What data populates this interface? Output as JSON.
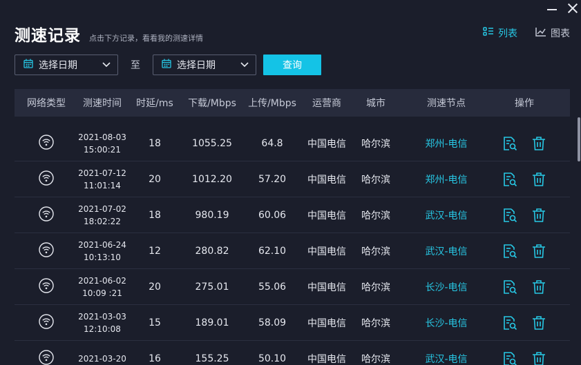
{
  "header": {
    "title": "测速记录",
    "subtitle": "点击下方记录，看看我的测速详情"
  },
  "view_switch": {
    "list_label": "列表",
    "chart_label": "图表"
  },
  "filter": {
    "start_placeholder": "选择日期",
    "separator": "至",
    "end_placeholder": "选择日期",
    "query_label": "查询"
  },
  "table": {
    "headers": [
      "网络类型",
      "测速时间",
      "时延/ms",
      "下载/Mbps",
      "上传/Mbps",
      "运营商",
      "城市",
      "测速节点",
      "操作"
    ],
    "rows": [
      {
        "date": "2021-08-03",
        "time": "15:00:21",
        "latency": "18",
        "download": "1055.25",
        "upload": "64.8",
        "isp": "中国电信",
        "city": "哈尔滨",
        "node": "郑州-电信"
      },
      {
        "date": "2021-07-12",
        "time": "11:01:14",
        "latency": "20",
        "download": "1012.20",
        "upload": "57.20",
        "isp": "中国电信",
        "city": "哈尔滨",
        "node": "郑州-电信"
      },
      {
        "date": "2021-07-02",
        "time": "18:02:22",
        "latency": "18",
        "download": "980.19",
        "upload": "60.06",
        "isp": "中国电信",
        "city": "哈尔滨",
        "node": "武汉-电信"
      },
      {
        "date": "2021-06-24",
        "time": "10:13:10",
        "latency": "12",
        "download": "280.82",
        "upload": "62.10",
        "isp": "中国电信",
        "city": "哈尔滨",
        "node": "武汉-电信"
      },
      {
        "date": "2021-06-02",
        "time": "10:09 :21",
        "latency": "20",
        "download": "275.01",
        "upload": "55.06",
        "isp": "中国电信",
        "city": "哈尔滨",
        "node": "长沙-电信"
      },
      {
        "date": "2021-03-03",
        "time": "12:10:08",
        "latency": "15",
        "download": "189.01",
        "upload": "58.09",
        "isp": "中国电信",
        "city": "哈尔滨",
        "node": "长沙-电信"
      },
      {
        "date": "2021-03-20",
        "time": "",
        "latency": "16",
        "download": "155.25",
        "upload": "50.10",
        "isp": "中国电信",
        "city": "哈尔滨",
        "node": "武汉-电信"
      }
    ]
  },
  "colors": {
    "background": "#1b1e2b",
    "accent": "#27c8e5",
    "button": "#14c3e6",
    "header_row": "#272b3c"
  },
  "icons": {
    "network": "wifi-icon",
    "detail": "report-search-icon",
    "delete": "trash-icon",
    "calendar": "calendar-icon",
    "list": "list-icon",
    "chart": "line-chart-icon"
  }
}
